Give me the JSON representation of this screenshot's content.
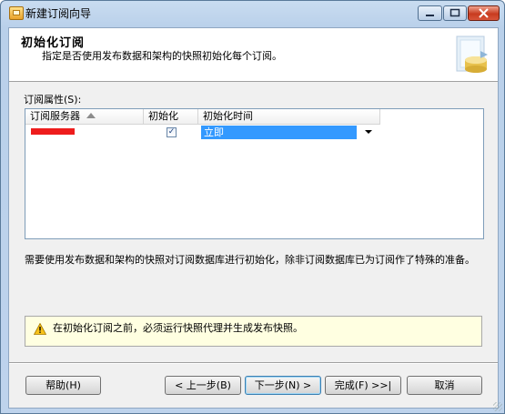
{
  "window": {
    "title": "新建订阅向导"
  },
  "header": {
    "title": "初始化订阅",
    "subtitle": "指定是否使用发布数据和架构的快照初始化每个订阅。"
  },
  "properties": {
    "label": "订阅属性(S):",
    "columns": [
      "订阅服务器",
      "初始化",
      "初始化时间"
    ],
    "rows": [
      {
        "server": "",
        "initialize": true,
        "init_time": "立即"
      }
    ]
  },
  "description": "需要使用发布数据和架构的快照对订阅数据库进行初始化，除非订阅数据库已为订阅作了特殊的准备。",
  "warning": {
    "text": "在初始化订阅之前，必须运行快照代理并生成发布快照。"
  },
  "buttons": {
    "help": "帮助(H)",
    "prev": "< 上一步(B)",
    "next": "下一步(N) >",
    "finish": "完成(F) >>|",
    "cancel": "取消"
  },
  "colors": {
    "selection": "#3399ff",
    "warning_bg": "#ffffe1",
    "redaction": "#ee1c1c"
  }
}
